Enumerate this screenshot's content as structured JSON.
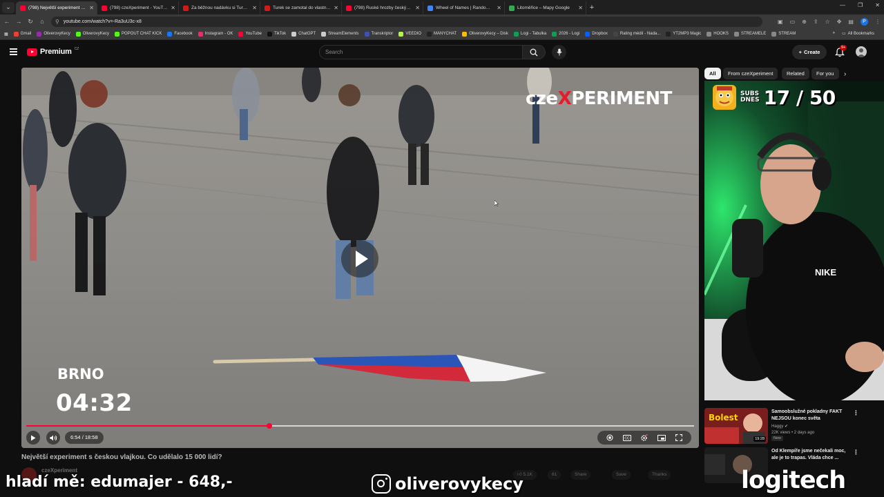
{
  "browser": {
    "tabs": [
      {
        "title": "(798) Největší experiment s čes",
        "color": "#ff0033",
        "active": true
      },
      {
        "title": "(798) czeXperiment - YouTube",
        "color": "#ff0033",
        "active": false
      },
      {
        "title": "Za běžnou nadávku si Turek vy",
        "color": "#d11a1a",
        "active": false
      },
      {
        "title": "Turek se zamotal do vlastních l",
        "color": "#d11a1a",
        "active": false
      },
      {
        "title": "(798) Ruské hrozby českým zbr",
        "color": "#ff0033",
        "active": false
      },
      {
        "title": "Wheel of Names | Random nan",
        "color": "#4285f4",
        "active": false
      },
      {
        "title": "Litoměřice – Mapy Google",
        "color": "#34a853",
        "active": false
      }
    ],
    "new_tab": "+",
    "url": "youtube.com/watch?v=-Ra3uU3c-x8",
    "bookmarks": [
      {
        "label": "Gmail",
        "color": "#ea4335"
      },
      {
        "label": "OliverovyKecy",
        "color": "#9c27b0"
      },
      {
        "label": "OliverovyKecy",
        "color": "#53fc18"
      },
      {
        "label": "POPOUT CHAT KICK",
        "color": "#53fc18"
      },
      {
        "label": "Facebook",
        "color": "#1877f2"
      },
      {
        "label": "Instagram - OK",
        "color": "#e1306c"
      },
      {
        "label": "YouTube",
        "color": "#ff0033"
      },
      {
        "label": "TikTok",
        "color": "#111111"
      },
      {
        "label": "ChatGPT",
        "color": "#cccccc"
      },
      {
        "label": "StreamElements",
        "color": "#cccccc"
      },
      {
        "label": "Transkriptor",
        "color": "#3f51b5"
      },
      {
        "label": "VEEDIO",
        "color": "#b6f34a"
      },
      {
        "label": "MANYCHAT",
        "color": "#222222"
      },
      {
        "label": "OliverovyKecy – Disk",
        "color": "#fbbc04"
      },
      {
        "label": "Logi - Tabulka",
        "color": "#0f9d58"
      },
      {
        "label": "2026 - Logi",
        "color": "#0f9d58"
      },
      {
        "label": "Dropbox",
        "color": "#0061ff"
      },
      {
        "label": "Rating médií - Nada...",
        "color": "#444444"
      },
      {
        "label": "YT2MP3 Magic",
        "color": "#222222"
      },
      {
        "label": "HOOKS",
        "color": "#888888"
      },
      {
        "label": "STREAMELE",
        "color": "#888888"
      },
      {
        "label": "STREAM",
        "color": "#888888"
      }
    ],
    "all_bookmarks": "All Bookmarks",
    "profile_initial": "P"
  },
  "yt": {
    "logo_text": "Premium",
    "logo_country": "CZ",
    "search_placeholder": "Search",
    "create_label": "Create",
    "notif_count": "9+",
    "chips": [
      "All",
      "From czeXperiment",
      "Related",
      "For you"
    ]
  },
  "video": {
    "watermark_a": "cze",
    "watermark_x": "X",
    "watermark_b": "PERIMENT",
    "city": "BRNO",
    "clock": "04:32",
    "time_current": "6:54",
    "time_sep": " / ",
    "time_total": "18:58",
    "progress_played_fraction": 0.3638,
    "progress_buffered_fraction": 1.0,
    "title": "Největší experiment s českou vlajkou. Co udělalo 15 000 lidí?",
    "channel": "czeXperiment",
    "actions": {
      "likes": "5.1K",
      "comments": "61",
      "share": "Share",
      "save": "Save",
      "thanks": "Thanks"
    }
  },
  "webcam": {
    "subs_line1": "SUBS",
    "subs_line2": "DNES",
    "subs_count": "17 / 50"
  },
  "recommendations": [
    {
      "title": "Samoobslužné pokladny FAKT NEJSOU konec světa",
      "channel": "Haggy",
      "views": "22K views",
      "sep": " • ",
      "age": "2 days ago",
      "badge": "New",
      "duration": "19:28",
      "thumb_text": "Bolest"
    },
    {
      "title": "Od Klempíře jsme nečekali moc, ale je to trapas. Vláda chce ...",
      "channel": "",
      "views": "",
      "sep": "",
      "age": "",
      "badge": "",
      "duration": "",
      "thumb_text": ""
    }
  ],
  "overlays": {
    "donation": "hladí mě: edumajer - 648,-",
    "instagram": "oliverovykecy",
    "sponsor": "logitech"
  }
}
